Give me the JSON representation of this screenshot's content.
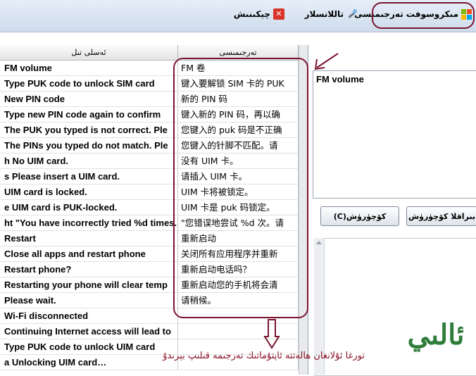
{
  "toolbar": {
    "microsoft_translate": "مىكروسوفت تەرجىمىسى",
    "select_all": "تاللانسلار",
    "check": "چېكىنىش"
  },
  "grid": {
    "headers": {
      "source": "ئەسلى تىل",
      "translation": "تەرجىمىسى"
    },
    "rows": [
      {
        "src": "FM volume",
        "tr": "FM 卷"
      },
      {
        "src": "Type PUK code to unlock SIM card",
        "tr": "键入要解锁 SIM 卡的 PUK"
      },
      {
        "src": "New PIN code",
        "tr": "新的 PIN 码"
      },
      {
        "src": "Type new PIN code again to confirm",
        "tr": "键入新的 PIN 码，再以确"
      },
      {
        "src": "The PUK you typed is not correct. Ple",
        "tr": "您键入的 puk 码是不正确"
      },
      {
        "src": "The PINs you typed do not match. Ple",
        "tr": "您键入的针脚不匹配。请"
      },
      {
        "src": "h No UIM card.",
        "tr": "没有 UIM 卡。"
      },
      {
        "src": "s  Please insert a UIM card.",
        "tr": "请插入 UIM 卡。"
      },
      {
        "src": "UIM card is locked.",
        "tr": "UIM 卡将被锁定。"
      },
      {
        "src": "e  UIM card is PUK-locked.",
        "tr": "UIM 卡是 puk 码锁定。"
      },
      {
        "src": "ht \"You have incorrectly tried %d times.",
        "tr": "\"您错误地尝试 %d 次。请"
      },
      {
        "src": "Restart",
        "tr": "重新启动"
      },
      {
        "src": "Close all apps and restart phone",
        "tr": "关闭所有应用程序并重新"
      },
      {
        "src": "Restart phone?",
        "tr": "重新启动电话吗？"
      },
      {
        "src": "Restarting your phone will clear temp",
        "tr": "重新启动您的手机将会清"
      },
      {
        "src": "Please wait.",
        "tr": "请稍候。"
      },
      {
        "src": "Wi-Fi disconnected",
        "tr": ""
      },
      {
        "src": "Continuing Internet access will lead to",
        "tr": ""
      },
      {
        "src": "Type PUK code to unlock UIM card",
        "tr": ""
      },
      {
        "src": "a  Unlocking UIM card…",
        "tr": ""
      }
    ]
  },
  "panel": {
    "source_text": "FM volume",
    "copy_button": "كۆچۈرۈش(C)",
    "copy_all_button": "بىراقلا كۆچۈرۈش"
  },
  "annotation": {
    "caption": "تورغا ئۇلانغان ھالەتتە ئاپتۇماتىك تەرجىمە قىلىپ بېرىدۇ",
    "logo_text": "ئالىيقۇت"
  },
  "colors": {
    "annotation": "#7a1530",
    "logo": "#2e7d3a"
  }
}
